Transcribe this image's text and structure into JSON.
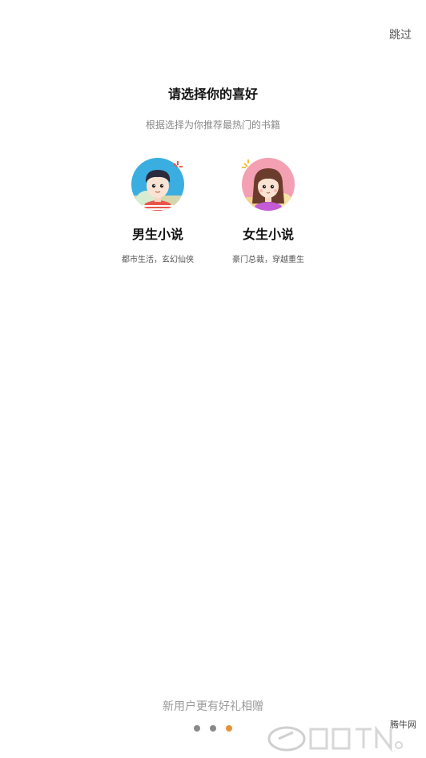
{
  "header": {
    "skip_label": "跳过"
  },
  "main": {
    "title": "请选择你的喜好",
    "subtitle": "根据选择为你推荐最热门的书籍",
    "options": [
      {
        "label": "男生小说",
        "description": "都市生活，玄幻仙侠",
        "icon": "male-avatar-icon"
      },
      {
        "label": "女生小说",
        "description": "豪门总裁，穿越重生",
        "icon": "female-avatar-icon"
      }
    ]
  },
  "footer": {
    "promo": "新用户更有好礼相赠",
    "pagination": {
      "count": 3,
      "active_index": 2,
      "active_color": "#e8913a",
      "inactive_color": "#8a8a8a"
    }
  },
  "watermark": {
    "text": "腾牛网"
  }
}
